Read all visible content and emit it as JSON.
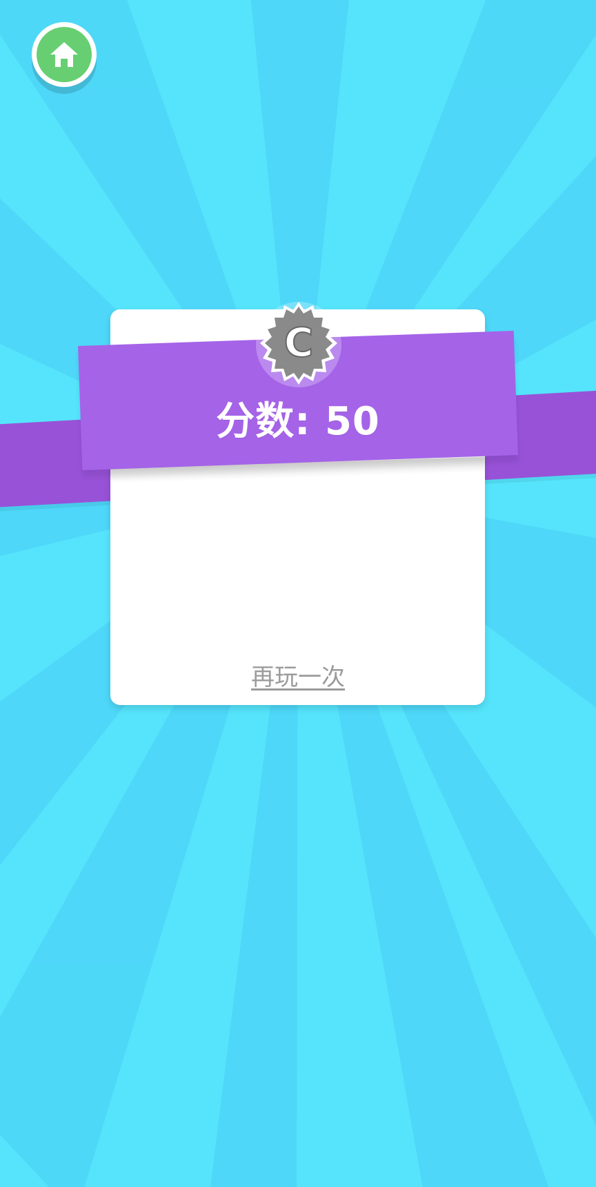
{
  "screen": {
    "background_color": "#55e4fb",
    "ray_colors": [
      "#55e4fb",
      "#4fd8f9"
    ]
  },
  "home_button": {
    "icon": "home-icon",
    "color": "#67cf72"
  },
  "result": {
    "grade": "C",
    "score_label": "分数: 50",
    "badge_color": "#8a8a8a",
    "ribbon_color": "#a563e8"
  },
  "actions": {
    "play_again": "再玩一次"
  }
}
